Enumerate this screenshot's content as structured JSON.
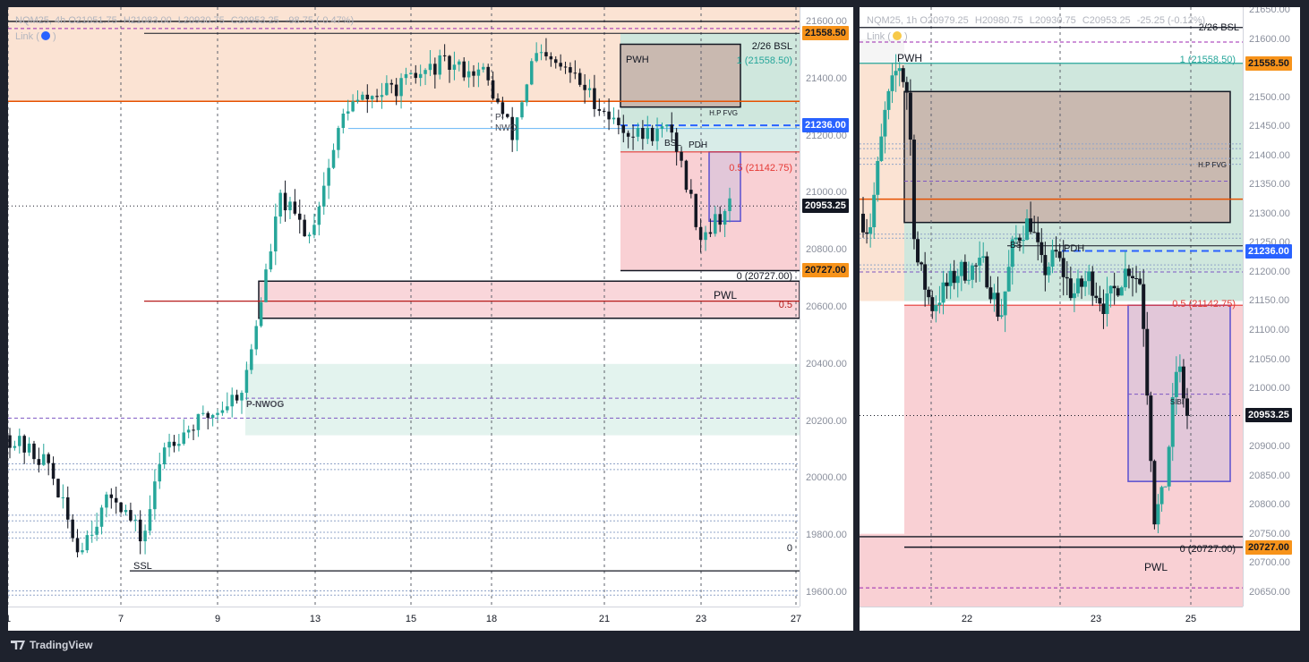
{
  "app": {
    "brand": "TradingView"
  },
  "charts": [
    {
      "id": "p1",
      "symbol": "NQM25",
      "interval": "4h",
      "ohlc": {
        "o": "21051.75",
        "h": "21083.00",
        "l": "20930.75",
        "c": "20953.25"
      },
      "change": "-98.75 (-0.47%)",
      "link_label": "Link (",
      "link_close": ")",
      "link_color": "#2962ff"
    },
    {
      "id": "p2",
      "symbol": "NQM25",
      "interval": "1h",
      "ohlc": {
        "o": "20979.25",
        "h": "20980.75",
        "l": "20930.75",
        "c": "20953.25"
      },
      "change": "-25.25 (-0.12%)",
      "link_label": "Link (",
      "link_close": ")",
      "link_color": "#f7c948"
    }
  ],
  "chart_data": [
    {
      "type": "candlestick",
      "symbol": "NQM25",
      "interval": "4h",
      "ylim": [
        19550,
        21650
      ],
      "y_ticks": [
        "21600.00",
        "21400.00",
        "21200.00",
        "21000.00",
        "20800.00",
        "20600.00",
        "20400.00",
        "20200.00",
        "20000.00",
        "19800.00",
        "19600.00"
      ],
      "x_ticks": [
        "1",
        "7",
        "9",
        "13",
        "15",
        "18",
        "21",
        "23",
        "27"
      ],
      "price_labels": [
        {
          "value": 21558.5,
          "text": "21558.50",
          "bg": "#f7931a",
          "fg": "#131722"
        },
        {
          "value": 21236.0,
          "text": "21236.00",
          "bg": "#2962ff",
          "fg": "#ffffff"
        },
        {
          "value": 20953.25,
          "text": "20953.25",
          "bg": "#131722",
          "fg": "#ffffff"
        },
        {
          "value": 20727.0,
          "text": "20727.00",
          "bg": "#f7931a",
          "fg": "#131722"
        }
      ],
      "annotations": [
        "2/26 BSL",
        "PWH",
        "1 (21558.50)",
        "H.P FVG",
        "P-NWOG",
        "PDH",
        "0.5 (21142.75)",
        "0 (20727.00)",
        "PWL",
        "0.5",
        "SSL",
        "0",
        "BSL",
        "P-NWO"
      ],
      "last_price": 20953.25
    },
    {
      "type": "candlestick",
      "symbol": "NQM25",
      "interval": "1h",
      "ylim": [
        20625,
        21655
      ],
      "y_ticks": [
        "21650.00",
        "21600.00",
        "21550.00",
        "21500.00",
        "21450.00",
        "21400.00",
        "21350.00",
        "21300.00",
        "21250.00",
        "21200.00",
        "21150.00",
        "21100.00",
        "21050.00",
        "21000.00",
        "20950.00",
        "20900.00",
        "20850.00",
        "20800.00",
        "20750.00",
        "20700.00",
        "20650.00"
      ],
      "x_ticks": [
        "22",
        "23",
        "25"
      ],
      "price_labels": [
        {
          "value": 21558.5,
          "text": "21558.50",
          "bg": "#f7931a",
          "fg": "#131722"
        },
        {
          "value": 21236.0,
          "text": "21236.00",
          "bg": "#2962ff",
          "fg": "#ffffff"
        },
        {
          "value": 20953.25,
          "text": "20953.25",
          "bg": "#131722",
          "fg": "#ffffff"
        },
        {
          "value": 20727.0,
          "text": "20727.00",
          "bg": "#f7931a",
          "fg": "#131722"
        }
      ],
      "annotations": [
        "2/26 BSL",
        "PWH",
        "1 (21558.50)",
        "H.P FVG",
        "PDH",
        "0.5 (21142.75)",
        "SIBI",
        "0 (20727.00)",
        "PWL",
        "BS"
      ],
      "last_price": 20953.25
    }
  ]
}
